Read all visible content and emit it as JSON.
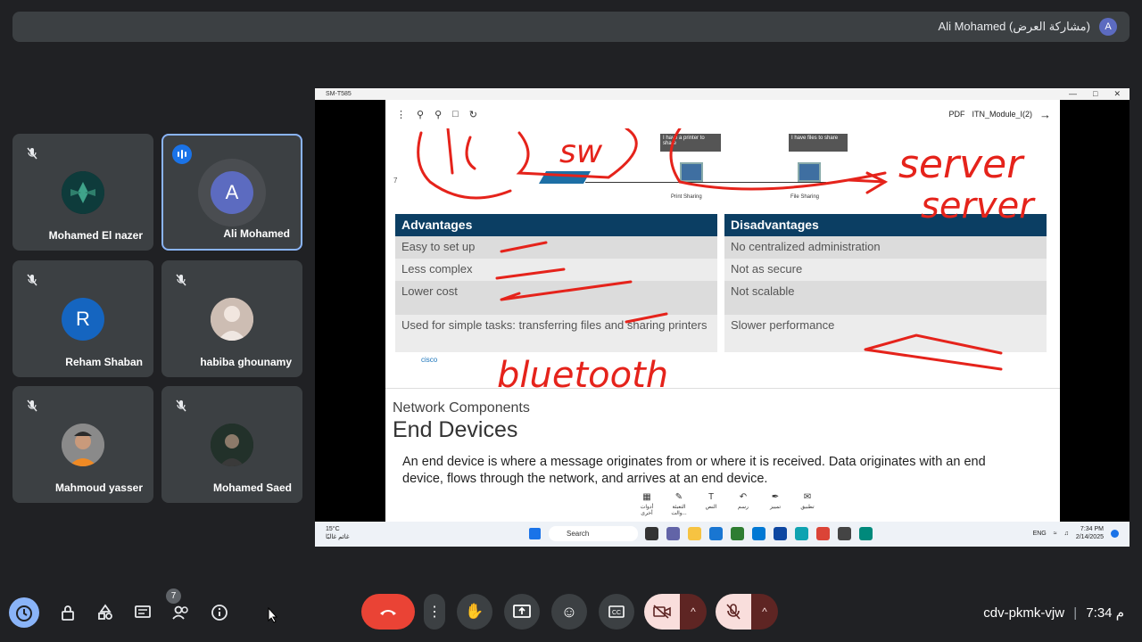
{
  "presenter": {
    "label": "Ali Mohamed (مشاركة العرض)",
    "avatar_letter": "A"
  },
  "participants": [
    {
      "name": "Mohamed El nazer",
      "avatar": ""
    },
    {
      "name": "Ali Mohamed",
      "avatar": "A"
    },
    {
      "name": "Reham Shaban",
      "avatar": "R"
    },
    {
      "name": "habiba ghounamy",
      "avatar": ""
    },
    {
      "name": "Mahmoud yasser",
      "avatar": ""
    },
    {
      "name": "Mohamed Saed",
      "avatar": ""
    }
  ],
  "shared_window": {
    "title": "SM-T585",
    "pdf_label": "PDF",
    "document": "ITN_Module_I(2)",
    "slide_number": "7",
    "diagram": {
      "callout_printer": "I have a printer to share",
      "callout_files": "I have files to share",
      "print_label": "Print Sharing",
      "file_label": "File Sharing"
    },
    "table": {
      "headers": [
        "Advantages",
        "Disadvantages"
      ],
      "rows": [
        [
          "Easy to set up",
          "No centralized administration"
        ],
        [
          "Less complex",
          "Not as secure"
        ],
        [
          "Lower cost",
          "Not scalable"
        ],
        [
          "Used for simple tasks: transferring files and sharing printers",
          "Slower performance"
        ]
      ]
    },
    "cisco": "cisco",
    "section_label": "Network Components",
    "section_title": "End Devices",
    "body": "An end device is where a message originates from or where it is received. Data originates with an end device, flows through the network, and arrives at an end device.",
    "tools": [
      "تطبيق",
      "تمييز",
      "رسم",
      "النص",
      "التعبئة والت...",
      "أدوات أخرى"
    ],
    "annotations": [
      "server",
      "server",
      "bluetooth",
      "sw"
    ],
    "taskbar": {
      "weather_temp": "15°C",
      "weather_desc": "غائم غالبًا",
      "search": "Search",
      "lang": "ENG",
      "time": "7:34 PM",
      "date": "2/14/2025"
    }
  },
  "controls": {
    "people_badge": "7",
    "meeting_code": "cdv-pkmk-vjw",
    "time": "7:34 م"
  },
  "colors": {
    "end_call": "#ea4335",
    "accent": "#8ab4f8",
    "table_header": "#0b3e63",
    "annotation": "#e5231b"
  }
}
